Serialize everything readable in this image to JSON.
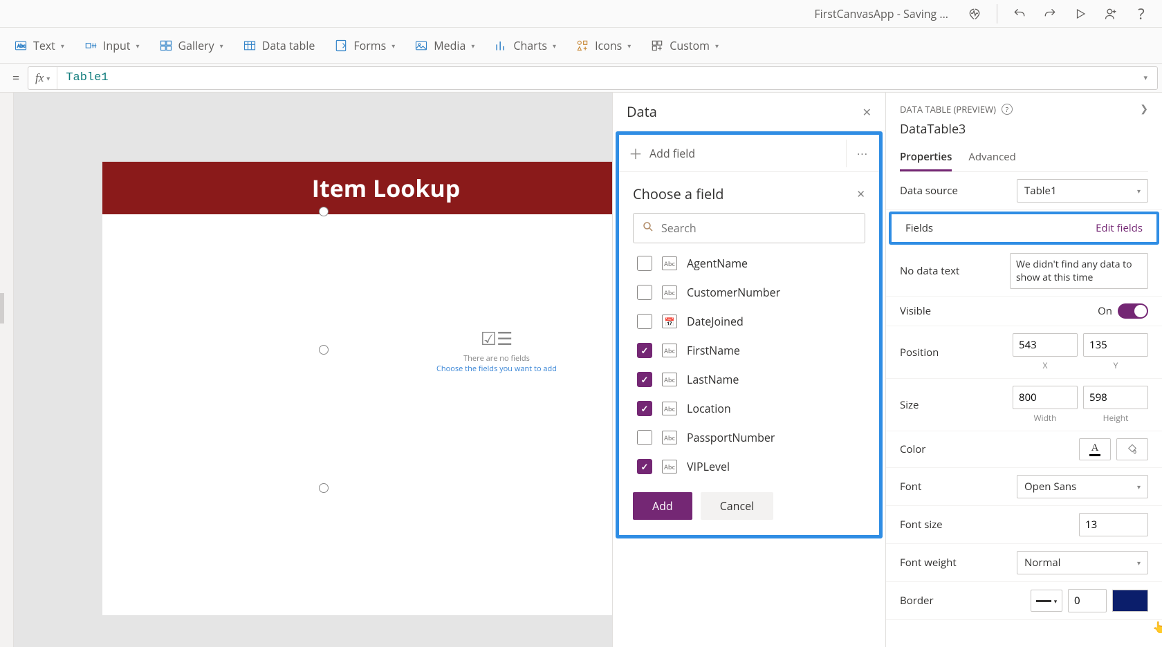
{
  "titlebar": {
    "app_title": "FirstCanvasApp - Saving ..."
  },
  "ribbon": {
    "items": [
      {
        "label": "Text"
      },
      {
        "label": "Input"
      },
      {
        "label": "Gallery"
      },
      {
        "label": "Data table"
      },
      {
        "label": "Forms"
      },
      {
        "label": "Media"
      },
      {
        "label": "Charts"
      },
      {
        "label": "Icons"
      },
      {
        "label": "Custom"
      }
    ]
  },
  "formula": {
    "value": "Table1"
  },
  "canvas": {
    "header_text": "Item Lookup",
    "empty_line1": "There are no fields",
    "empty_line2": "Choose the fields you want to add"
  },
  "data_panel": {
    "title": "Data",
    "add_field": "Add field",
    "choose_title": "Choose a field",
    "search_placeholder": "Search",
    "fields": [
      {
        "name": "AgentName",
        "type": "Abc",
        "checked": false
      },
      {
        "name": "CustomerNumber",
        "type": "Abc",
        "checked": false
      },
      {
        "name": "DateJoined",
        "type": "cal",
        "checked": false
      },
      {
        "name": "FirstName",
        "type": "Abc",
        "checked": true
      },
      {
        "name": "LastName",
        "type": "Abc",
        "checked": true
      },
      {
        "name": "Location",
        "type": "Abc",
        "checked": true
      },
      {
        "name": "PassportNumber",
        "type": "Abc",
        "checked": false
      },
      {
        "name": "VIPLevel",
        "type": "Abc",
        "checked": true
      }
    ],
    "add_btn": "Add",
    "cancel_btn": "Cancel"
  },
  "props": {
    "section": "DATA TABLE (PREVIEW)",
    "name": "DataTable3",
    "tab_properties": "Properties",
    "tab_advanced": "Advanced",
    "data_source_label": "Data source",
    "data_source_value": "Table1",
    "fields_label": "Fields",
    "edit_fields": "Edit fields",
    "nodata_label": "No data text",
    "nodata_value": "We didn't find any data to show at this time",
    "visible_label": "Visible",
    "visible_state": "On",
    "position_label": "Position",
    "pos_x": "543",
    "pos_y": "135",
    "pos_xl": "X",
    "pos_yl": "Y",
    "size_label": "Size",
    "size_w": "800",
    "size_h": "598",
    "size_wl": "Width",
    "size_hl": "Height",
    "color_label": "Color",
    "font_label": "Font",
    "font_value": "Open Sans",
    "fontsize_label": "Font size",
    "fontsize_value": "13",
    "fontweight_label": "Font weight",
    "fontweight_value": "Normal",
    "border_label": "Border",
    "border_width": "0"
  }
}
